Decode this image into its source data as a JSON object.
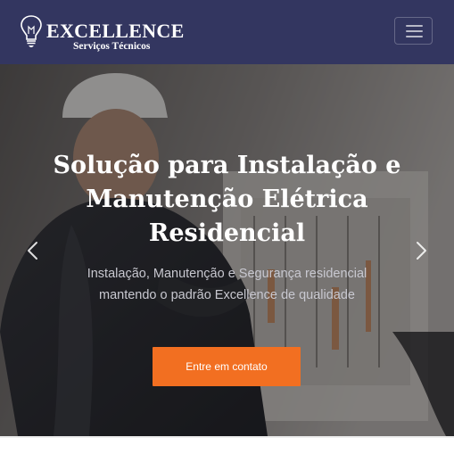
{
  "navbar": {
    "brand": {
      "name": "EXCELLENCE",
      "tagline": "Serviços Técnicos",
      "logo_icon": "lightbulb-icon"
    },
    "menu_icon": "hamburger-menu-icon",
    "background_color": "#333660"
  },
  "hero": {
    "title": "Solução para Instalação e Manutenção Elétrica Residencial",
    "subtitle": "Instalação, Manutenção e Segurança residencial mantendo o padrão Excellence de qualidade",
    "cta_label": "Entre em contato",
    "cta_color": "#f26f21",
    "prev_icon": "chevron-left-icon",
    "next_icon": "chevron-right-icon"
  }
}
